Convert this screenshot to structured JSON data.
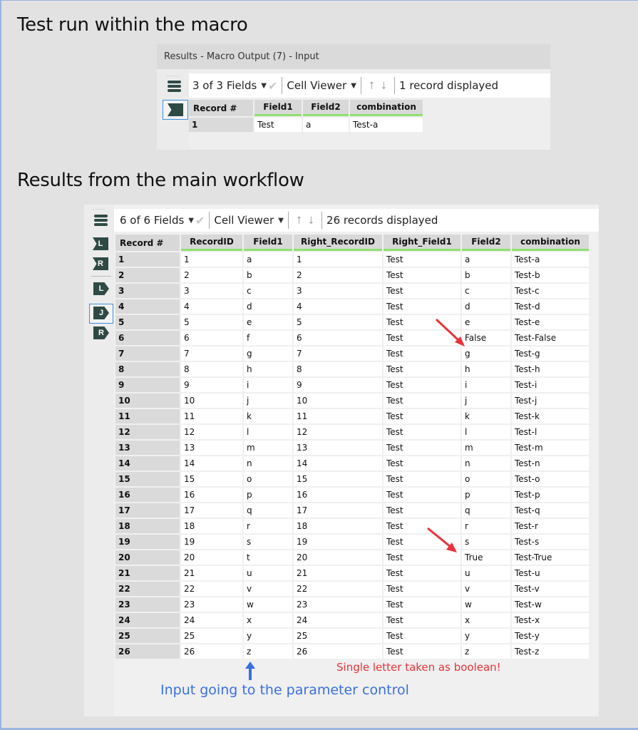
{
  "headings": {
    "macro_test": "Test run within the macro",
    "main_results": "Results from the main workflow"
  },
  "macro_panel": {
    "title": "Results - Macro Output (7) - Input",
    "fields_selector": "3 of 3 Fields",
    "viewer_selector": "Cell Viewer",
    "records_status": "1 record displayed",
    "columns": [
      "Record #",
      "Field1",
      "Field2",
      "combination"
    ],
    "rows": [
      [
        "1",
        "Test",
        "a",
        "Test-a"
      ]
    ]
  },
  "main_panel": {
    "fields_selector": "6 of 6 Fields",
    "viewer_selector": "Cell Viewer",
    "records_status": "26 records displayed",
    "anchors": [
      "L",
      "R",
      "L",
      "J",
      "R"
    ],
    "columns": [
      "Record #",
      "RecordID",
      "Field1",
      "Right_RecordID",
      "Right_Field1",
      "Field2",
      "combination"
    ],
    "rows": [
      [
        "1",
        "1",
        "a",
        "1",
        "Test",
        "a",
        "Test-a"
      ],
      [
        "2",
        "2",
        "b",
        "2",
        "Test",
        "b",
        "Test-b"
      ],
      [
        "3",
        "3",
        "c",
        "3",
        "Test",
        "c",
        "Test-c"
      ],
      [
        "4",
        "4",
        "d",
        "4",
        "Test",
        "d",
        "Test-d"
      ],
      [
        "5",
        "5",
        "e",
        "5",
        "Test",
        "e",
        "Test-e"
      ],
      [
        "6",
        "6",
        "f",
        "6",
        "Test",
        "False",
        "Test-False"
      ],
      [
        "7",
        "7",
        "g",
        "7",
        "Test",
        "g",
        "Test-g"
      ],
      [
        "8",
        "8",
        "h",
        "8",
        "Test",
        "h",
        "Test-h"
      ],
      [
        "9",
        "9",
        "i",
        "9",
        "Test",
        "i",
        "Test-i"
      ],
      [
        "10",
        "10",
        "j",
        "10",
        "Test",
        "j",
        "Test-j"
      ],
      [
        "11",
        "11",
        "k",
        "11",
        "Test",
        "k",
        "Test-k"
      ],
      [
        "12",
        "12",
        "l",
        "12",
        "Test",
        "l",
        "Test-l"
      ],
      [
        "13",
        "13",
        "m",
        "13",
        "Test",
        "m",
        "Test-m"
      ],
      [
        "14",
        "14",
        "n",
        "14",
        "Test",
        "n",
        "Test-n"
      ],
      [
        "15",
        "15",
        "o",
        "15",
        "Test",
        "o",
        "Test-o"
      ],
      [
        "16",
        "16",
        "p",
        "16",
        "Test",
        "p",
        "Test-p"
      ],
      [
        "17",
        "17",
        "q",
        "17",
        "Test",
        "q",
        "Test-q"
      ],
      [
        "18",
        "18",
        "r",
        "18",
        "Test",
        "r",
        "Test-r"
      ],
      [
        "19",
        "19",
        "s",
        "19",
        "Test",
        "s",
        "Test-s"
      ],
      [
        "20",
        "20",
        "t",
        "20",
        "Test",
        "True",
        "Test-True"
      ],
      [
        "21",
        "21",
        "u",
        "21",
        "Test",
        "u",
        "Test-u"
      ],
      [
        "22",
        "22",
        "v",
        "22",
        "Test",
        "v",
        "Test-v"
      ],
      [
        "23",
        "23",
        "w",
        "23",
        "Test",
        "w",
        "Test-w"
      ],
      [
        "24",
        "24",
        "x",
        "24",
        "Test",
        "x",
        "Test-x"
      ],
      [
        "25",
        "25",
        "y",
        "25",
        "Test",
        "y",
        "Test-y"
      ],
      [
        "26",
        "26",
        "z",
        "26",
        "Test",
        "z",
        "Test-z"
      ]
    ]
  },
  "annotations": {
    "boolean_note": "Single letter taken as boolean!",
    "input_note": "Input going to the parameter control",
    "note_colors": {
      "red": "#e8333a",
      "blue": "#3a6fe0"
    }
  }
}
